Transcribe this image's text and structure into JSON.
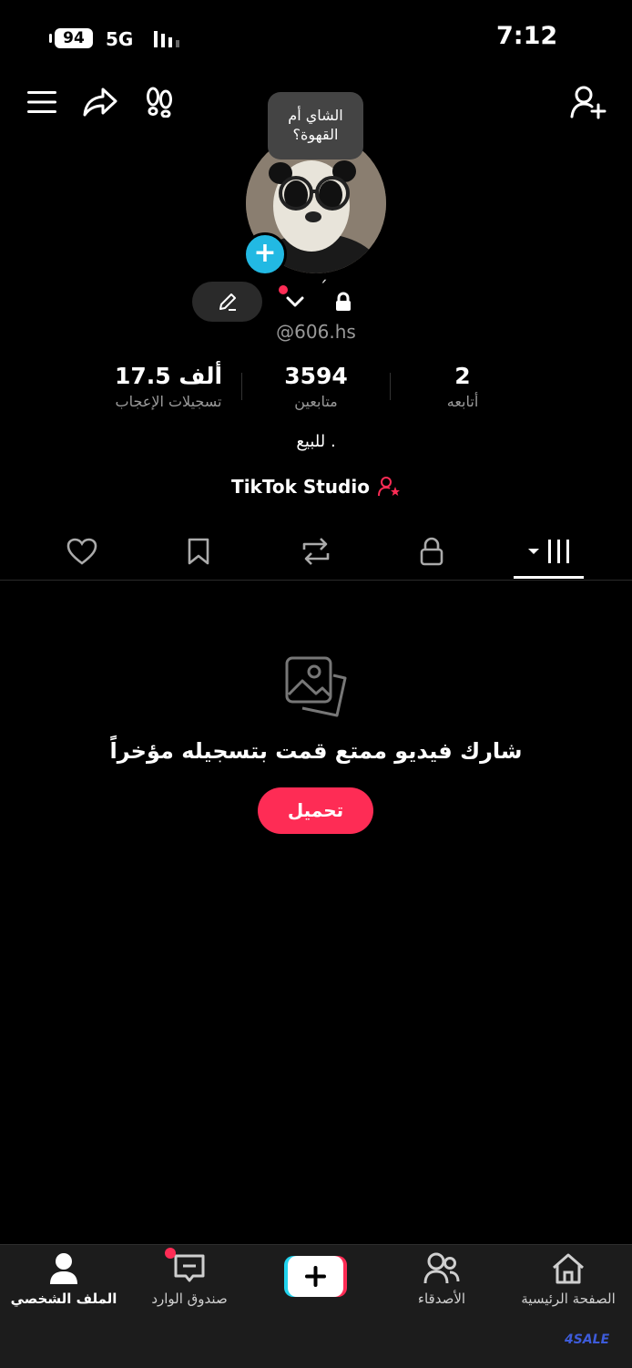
{
  "status_bar": {
    "battery": "94",
    "network": "5G",
    "time": "7:12"
  },
  "bubble": {
    "text": "الشاي أم القهوة؟"
  },
  "profile": {
    "handle": "@606.hs",
    "accent_mark": "´",
    "bio": "للبيع .",
    "studio_label": "TikTok Studio"
  },
  "stats": [
    {
      "value": "17.5 ألف",
      "label": "تسجيلات الإعجاب"
    },
    {
      "value": "3594",
      "label": "متابعين"
    },
    {
      "value": "2",
      "label": "أتابعه"
    }
  ],
  "empty_state": {
    "message": "شارك فيديو ممتع قمت بتسجيله مؤخراً",
    "button": "تحميل"
  },
  "bottom_nav": [
    {
      "label": "الملف الشخصي",
      "icon": "profile-icon"
    },
    {
      "label": "صندوق الوارد",
      "icon": "inbox-icon"
    },
    {
      "label": "الأصدقاء",
      "icon": "friends-icon"
    },
    {
      "label": "الصفحة الرئيسية",
      "icon": "home-icon"
    }
  ],
  "watermark": "4SALE",
  "colors": {
    "accent": "#fe2c55",
    "cyan": "#22b9e3",
    "background": "#000000"
  }
}
